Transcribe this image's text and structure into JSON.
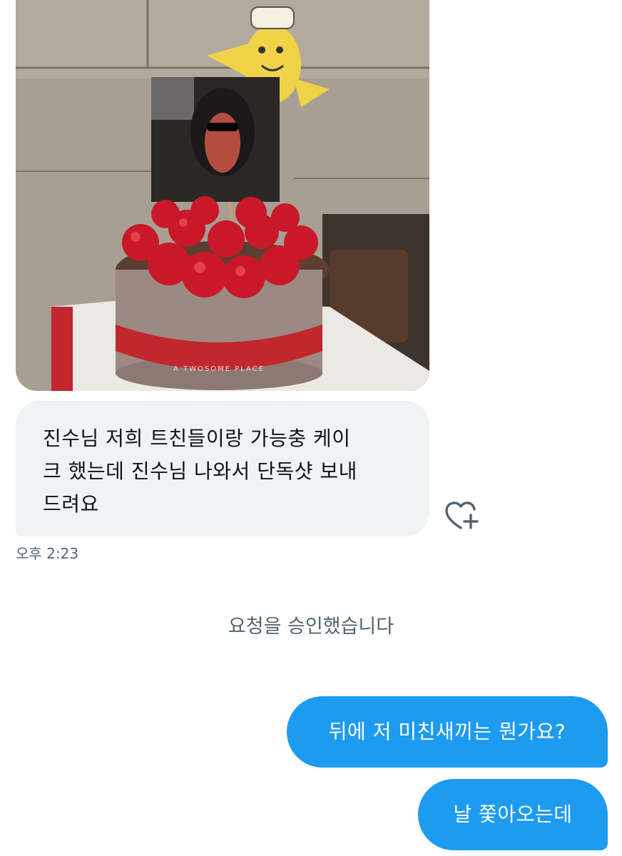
{
  "conversation": {
    "received_image": {
      "alt": "strawberry cake photo",
      "cake_ribbon_text": "A TWOSOME PLACE"
    },
    "received_message": {
      "lines": [
        "진수님 저희 트친들이랑 가능충 케이",
        "크 했는데 진수님 나와서 단독샷 보내",
        "드려요"
      ],
      "time": "오후 2:23"
    },
    "react_icon": "heart-plus-icon",
    "system_notice": "요청을 승인했습니다",
    "sent_messages": [
      {
        "text": "뒤에 저 미친새끼는 뭔가요?"
      },
      {
        "text": "날 쫓아오는데"
      }
    ]
  },
  "colors": {
    "sent_bubble": "#1d9bf0",
    "received_bubble": "#eff3f4",
    "secondary_text": "#536471"
  }
}
